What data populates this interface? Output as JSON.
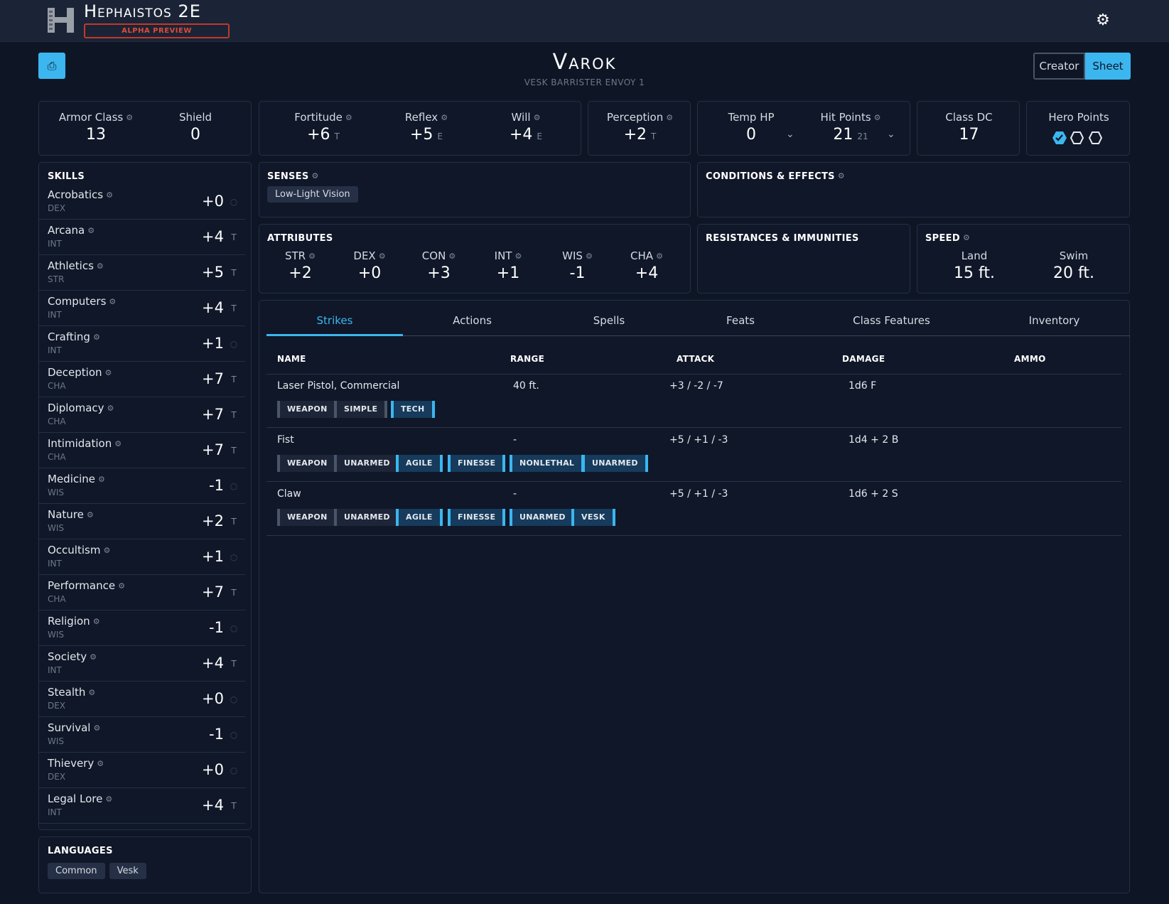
{
  "app": {
    "title": "Hephaistos 2E",
    "badge": "ALPHA PREVIEW"
  },
  "character": {
    "name": "Varok",
    "subtitle": "VESK BARRISTER ENVOY 1"
  },
  "mode": {
    "creator": "Creator",
    "sheet": "Sheet",
    "active": "Sheet"
  },
  "defense": {
    "armor_class": {
      "label": "Armor Class",
      "value": "13"
    },
    "shield": {
      "label": "Shield",
      "value": "0"
    }
  },
  "saves": [
    {
      "label": "Fortitude",
      "value": "+6",
      "prof": "T"
    },
    {
      "label": "Reflex",
      "value": "+5",
      "prof": "E"
    },
    {
      "label": "Will",
      "value": "+4",
      "prof": "E"
    }
  ],
  "perception": {
    "label": "Perception",
    "value": "+2",
    "prof": "T"
  },
  "hp": {
    "temp_label": "Temp HP",
    "temp_value": "0",
    "label": "Hit Points",
    "value": "21",
    "max": "21"
  },
  "class_dc": {
    "label": "Class DC",
    "value": "17"
  },
  "hero_points": {
    "label": "Hero Points",
    "filled": 1,
    "total": 3
  },
  "skills_title": "SKILLS",
  "skills": [
    {
      "name": "Acrobatics",
      "attr": "DEX",
      "value": "+0",
      "prof": ""
    },
    {
      "name": "Arcana",
      "attr": "INT",
      "value": "+4",
      "prof": "T"
    },
    {
      "name": "Athletics",
      "attr": "STR",
      "value": "+5",
      "prof": "T"
    },
    {
      "name": "Computers",
      "attr": "INT",
      "value": "+4",
      "prof": "T"
    },
    {
      "name": "Crafting",
      "attr": "INT",
      "value": "+1",
      "prof": ""
    },
    {
      "name": "Deception",
      "attr": "CHA",
      "value": "+7",
      "prof": "T"
    },
    {
      "name": "Diplomacy",
      "attr": "CHA",
      "value": "+7",
      "prof": "T"
    },
    {
      "name": "Intimidation",
      "attr": "CHA",
      "value": "+7",
      "prof": "T"
    },
    {
      "name": "Medicine",
      "attr": "WIS",
      "value": "-1",
      "prof": ""
    },
    {
      "name": "Nature",
      "attr": "WIS",
      "value": "+2",
      "prof": "T"
    },
    {
      "name": "Occultism",
      "attr": "INT",
      "value": "+1",
      "prof": ""
    },
    {
      "name": "Performance",
      "attr": "CHA",
      "value": "+7",
      "prof": "T"
    },
    {
      "name": "Religion",
      "attr": "WIS",
      "value": "-1",
      "prof": ""
    },
    {
      "name": "Society",
      "attr": "INT",
      "value": "+4",
      "prof": "T"
    },
    {
      "name": "Stealth",
      "attr": "DEX",
      "value": "+0",
      "prof": ""
    },
    {
      "name": "Survival",
      "attr": "WIS",
      "value": "-1",
      "prof": ""
    },
    {
      "name": "Thievery",
      "attr": "DEX",
      "value": "+0",
      "prof": ""
    },
    {
      "name": "Legal Lore",
      "attr": "INT",
      "value": "+4",
      "prof": "T"
    }
  ],
  "languages": {
    "title": "LANGUAGES",
    "items": [
      "Common",
      "Vesk"
    ]
  },
  "senses": {
    "title": "SENSES",
    "items": [
      "Low-Light Vision"
    ]
  },
  "conditions": {
    "title": "CONDITIONS & EFFECTS"
  },
  "attributes": {
    "title": "ATTRIBUTES",
    "items": [
      {
        "label": "STR",
        "value": "+2"
      },
      {
        "label": "DEX",
        "value": "+0"
      },
      {
        "label": "CON",
        "value": "+3"
      },
      {
        "label": "INT",
        "value": "+1"
      },
      {
        "label": "WIS",
        "value": "-1"
      },
      {
        "label": "CHA",
        "value": "+4"
      }
    ]
  },
  "resistances": {
    "title": "RESISTANCES & IMMUNITIES"
  },
  "speed": {
    "title": "SPEED",
    "items": [
      {
        "label": "Land",
        "value": "15 ft."
      },
      {
        "label": "Swim",
        "value": "20 ft."
      }
    ]
  },
  "tabs": [
    "Strikes",
    "Actions",
    "Spells",
    "Feats",
    "Class Features",
    "Inventory"
  ],
  "active_tab": "Strikes",
  "strikes": {
    "headers": [
      "NAME",
      "RANGE",
      "ATTACK",
      "DAMAGE",
      "AMMO"
    ],
    "rows": [
      {
        "name": "Laser Pistol, Commercial",
        "range": "40 ft.",
        "attack": "+3 / -2 / -7",
        "damage": "1d6 F",
        "ammo": "",
        "tags": [
          {
            "t": "WEAPON",
            "c": "grey"
          },
          {
            "t": "SIMPLE",
            "c": "grey"
          },
          {
            "t": "TECH",
            "c": "blue"
          }
        ]
      },
      {
        "name": "Fist",
        "range": "-",
        "attack": "+5 / +1 / -3",
        "damage": "1d4 + 2 B",
        "ammo": "",
        "tags": [
          {
            "t": "WEAPON",
            "c": "grey"
          },
          {
            "t": "UNARMED",
            "c": "grey"
          },
          {
            "t": "AGILE",
            "c": "blue"
          },
          {
            "t": "FINESSE",
            "c": "blue"
          },
          {
            "t": "NONLETHAL",
            "c": "blue"
          },
          {
            "t": "UNARMED",
            "c": "blue"
          }
        ]
      },
      {
        "name": "Claw",
        "range": "-",
        "attack": "+5 / +1 / -3",
        "damage": "1d6 + 2 S",
        "ammo": "",
        "tags": [
          {
            "t": "WEAPON",
            "c": "grey"
          },
          {
            "t": "UNARMED",
            "c": "grey"
          },
          {
            "t": "AGILE",
            "c": "blue"
          },
          {
            "t": "FINESSE",
            "c": "blue"
          },
          {
            "t": "UNARMED",
            "c": "blue"
          },
          {
            "t": "VESK",
            "c": "blue"
          }
        ]
      }
    ]
  },
  "colors": {
    "accent": "#3cb6ef",
    "background": "#0e1626",
    "alpha_badge": "#c0392b"
  }
}
